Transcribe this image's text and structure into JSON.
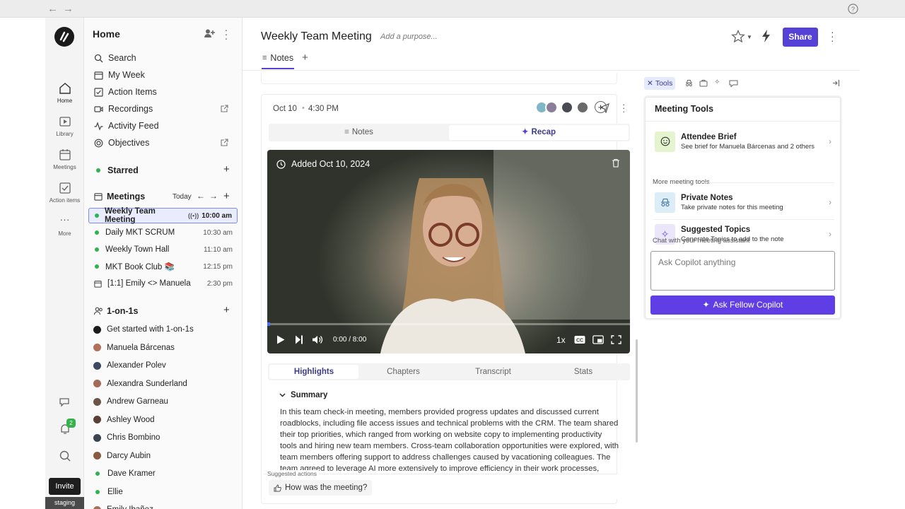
{
  "sidebar": {
    "title": "Home",
    "nav": [
      "Search",
      "My Week",
      "Action Items",
      "Recordings",
      "Activity Feed",
      "Objectives"
    ],
    "starred_label": "Starred",
    "meetings_label": "Meetings",
    "today_label": "Today",
    "meetings": [
      {
        "name": "Weekly Team Meeting",
        "time": "10:00 am",
        "dot": "#2fb350"
      },
      {
        "name": "Daily MKT SCRUM",
        "time": "10:30 am",
        "dot": "#2fb350"
      },
      {
        "name": "Weekly Town Hall",
        "time": "11:10 am",
        "dot": "#2fb350"
      },
      {
        "name": "MKT Book Club 📚",
        "time": "12:15 pm",
        "dot": "#2fb350"
      },
      {
        "name": "[1:1] Emily <> Manuela",
        "time": "2:30 pm",
        "dot": ""
      }
    ],
    "oneonones_label": "1-on-1s",
    "people": [
      {
        "name": "Get started with 1-on-1s",
        "color": "#1b1b1b"
      },
      {
        "name": "Manuela Bárcenas",
        "color": "#b0705a"
      },
      {
        "name": "Alexander Polev",
        "color": "#3b4a5e"
      },
      {
        "name": "Alexandra Sunderland",
        "color": "#a56a55"
      },
      {
        "name": "Andrew Garneau",
        "color": "#6a5548"
      },
      {
        "name": "Ashley Wood",
        "color": "#5a3f35"
      },
      {
        "name": "Chris Bombino",
        "color": "#3a4450"
      },
      {
        "name": "Darcy Aubin",
        "color": "#8a5a40"
      },
      {
        "name": "Dave Kramer",
        "color": "#2fb350"
      },
      {
        "name": "Ellie",
        "color": "#2fb350"
      },
      {
        "name": "Emily Ibañez",
        "color": "#a0705a"
      }
    ]
  },
  "rail": {
    "items": [
      "Home",
      "Library",
      "Meetings",
      "Action items",
      "More"
    ],
    "notif_count": "2",
    "invite": "Invite",
    "env": "staging"
  },
  "header": {
    "title": "Weekly Team Meeting",
    "purpose_placeholder": "Add a purpose...",
    "share": "Share",
    "tab": "Notes"
  },
  "meeting": {
    "date": "Oct 10",
    "time": "4:30 PM",
    "seg": [
      "Notes",
      "Recap"
    ],
    "video_added": "Added Oct 10, 2024",
    "video_time": "0:00 / 8:00",
    "video_speed": "1x",
    "subtabs": [
      "Highlights",
      "Chapters",
      "Transcript",
      "Stats"
    ],
    "summary_label": "Summary",
    "summary": "In this team check-in meeting, members provided progress updates and discussed current roadblocks, including file access issues and technical problems with the CRM. The team shared their top priorities, which ranged from working on website copy to implementing productivity tools and hiring new team members. Cross-team collaboration opportunities were explored, with team members offering support to address challenges caused by vacationing colleagues. The team agreed to leverage AI more extensively to improve efficiency in their work processes, particularly",
    "suggested_label": "Suggested actions",
    "suggested_action": "How was the meeting?"
  },
  "tools": {
    "tab_label": "Tools",
    "panel_title": "Meeting Tools",
    "attendee_title": "Attendee Brief",
    "attendee_sub": "See brief for Manuela Bárcenas and 2 others",
    "more_label": "More meeting tools",
    "private_title": "Private Notes",
    "private_sub": "Take private notes for this meeting",
    "topics_title": "Suggested Topics",
    "topics_sub": "Generate Topics to add to the note",
    "chat_label": "Chat with your meeting assistant",
    "copilot_placeholder": "Ask Copilot anything",
    "copilot_button": "Ask Fellow Copilot"
  },
  "colors": {
    "accent": "#5641d6",
    "copilot": "#5f3ee6",
    "selected_bg": "#e9ecfc"
  }
}
